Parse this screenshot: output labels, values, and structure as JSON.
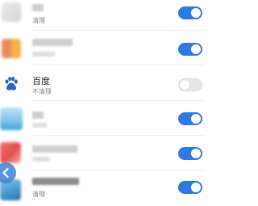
{
  "apps": [
    {
      "subtitle": "清理",
      "enabled": true
    },
    {
      "enabled": true
    },
    {
      "title": "百度",
      "subtitle": "不清理",
      "enabled": false
    },
    {
      "enabled": true
    },
    {
      "enabled": true
    },
    {
      "subtitle": "清理",
      "enabled": true
    }
  ],
  "colors": {
    "toggle_on": "#2c7be5",
    "toggle_off": "#e6e6e6",
    "baidu_blue": "#2e63c9"
  },
  "icons": {
    "baidu": "baidu-paw-icon",
    "back": "back-arrow-icon"
  }
}
